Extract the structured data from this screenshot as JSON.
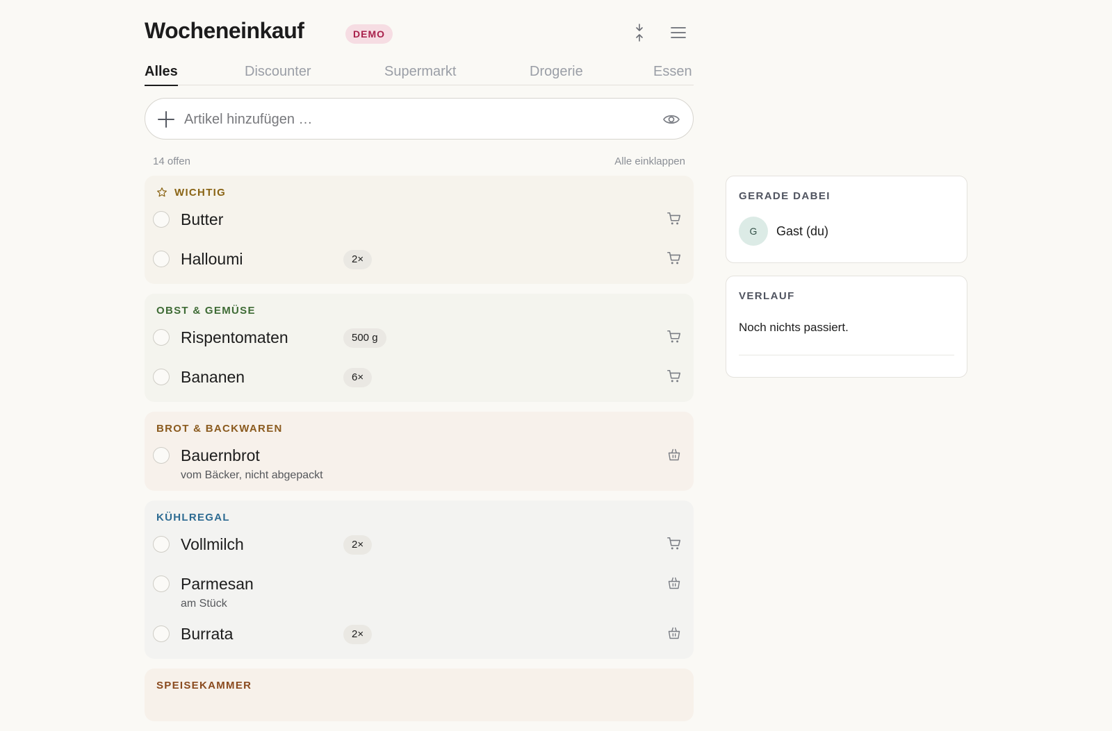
{
  "header": {
    "title": "Wocheneinkauf",
    "badge": "DEMO",
    "collapse_icon": "collapse-vertical-icon",
    "menu_icon": "hamburger-menu-icon"
  },
  "tabs": [
    {
      "label": "Alles",
      "active": true
    },
    {
      "label": "Discounter",
      "active": false
    },
    {
      "label": "Supermarkt",
      "active": false
    },
    {
      "label": "Drogerie",
      "active": false
    },
    {
      "label": "Essen",
      "active": false
    }
  ],
  "add_item": {
    "placeholder": "Artikel hinzufügen …",
    "value": "",
    "plus_icon": "plus-icon",
    "eye_icon": "eye-icon"
  },
  "summary": {
    "open_count": "14 offen",
    "collapse_all": "Alle einklappen"
  },
  "groups": [
    {
      "title": "WICHTIG",
      "color": "#8a6415",
      "icon": "star-icon",
      "items": [
        {
          "name": "Butter",
          "qty": "",
          "note": "",
          "action_icon": "cart-icon"
        },
        {
          "name": "Halloumi",
          "qty": "2×",
          "note": "",
          "action_icon": "cart-icon"
        }
      ]
    },
    {
      "title": "OBST & GEMÜSE",
      "color": "#3e6b35",
      "items": [
        {
          "name": "Rispentomaten",
          "qty": "500 g",
          "note": "",
          "action_icon": "cart-icon"
        },
        {
          "name": "Bananen",
          "qty": "6×",
          "note": "",
          "action_icon": "cart-icon"
        }
      ]
    },
    {
      "title": "BROT & BACKWAREN",
      "color": "#8a5a1e",
      "items": [
        {
          "name": "Bauernbrot",
          "qty": "",
          "note": "vom Bäcker, nicht abgepackt",
          "action_icon": "basket-icon"
        }
      ]
    },
    {
      "title": "KÜHLREGAL",
      "color": "#2d6b92",
      "items": [
        {
          "name": "Vollmilch",
          "qty": "2×",
          "note": "",
          "action_icon": "cart-icon"
        },
        {
          "name": "Parmesan",
          "qty": "",
          "note": "am Stück",
          "action_icon": "basket-icon"
        },
        {
          "name": "Burrata",
          "qty": "2×",
          "note": "",
          "action_icon": "basket-icon"
        }
      ]
    },
    {
      "title": "SPEISEKAMMER",
      "color": "#8a4a1e",
      "items": []
    }
  ],
  "presence": {
    "title": "GERADE DABEI",
    "avatar_initial": "G",
    "user": "Gast (du)"
  },
  "history": {
    "title": "VERLAUF",
    "empty": "Noch nichts passiert."
  }
}
